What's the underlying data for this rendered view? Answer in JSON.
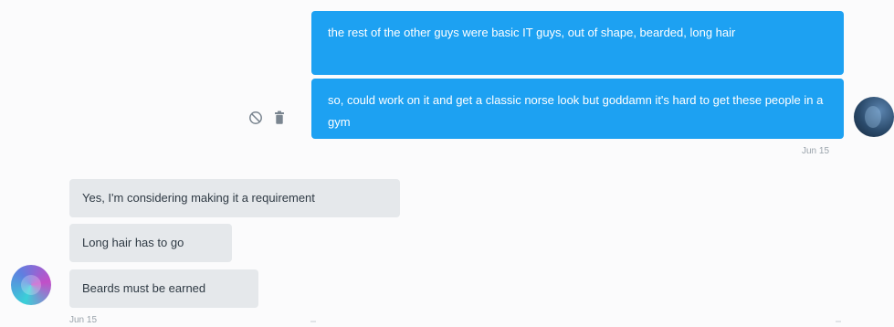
{
  "conversation": {
    "outgoing": {
      "messages": [
        {
          "text": "the rest of the other guys were basic IT guys, out of shape, bearded, long hair"
        },
        {
          "text": "so, could work on it and get a classic norse look but goddamn it's hard to get these people in a gym"
        }
      ],
      "timestamp": "Jun 15",
      "actions": [
        {
          "icon": "block-icon"
        },
        {
          "icon": "trash-icon"
        }
      ]
    },
    "incoming": {
      "messages": [
        {
          "text": "Yes, I'm considering making it a requirement"
        },
        {
          "text": "Long hair has to go"
        },
        {
          "text": "Beards must be earned"
        }
      ],
      "timestamp": "Jun 15"
    }
  },
  "colors": {
    "outgoing_bubble": "#1da1f2",
    "incoming_bubble": "#e5e8eb",
    "timestamp": "#9aa3ab"
  }
}
